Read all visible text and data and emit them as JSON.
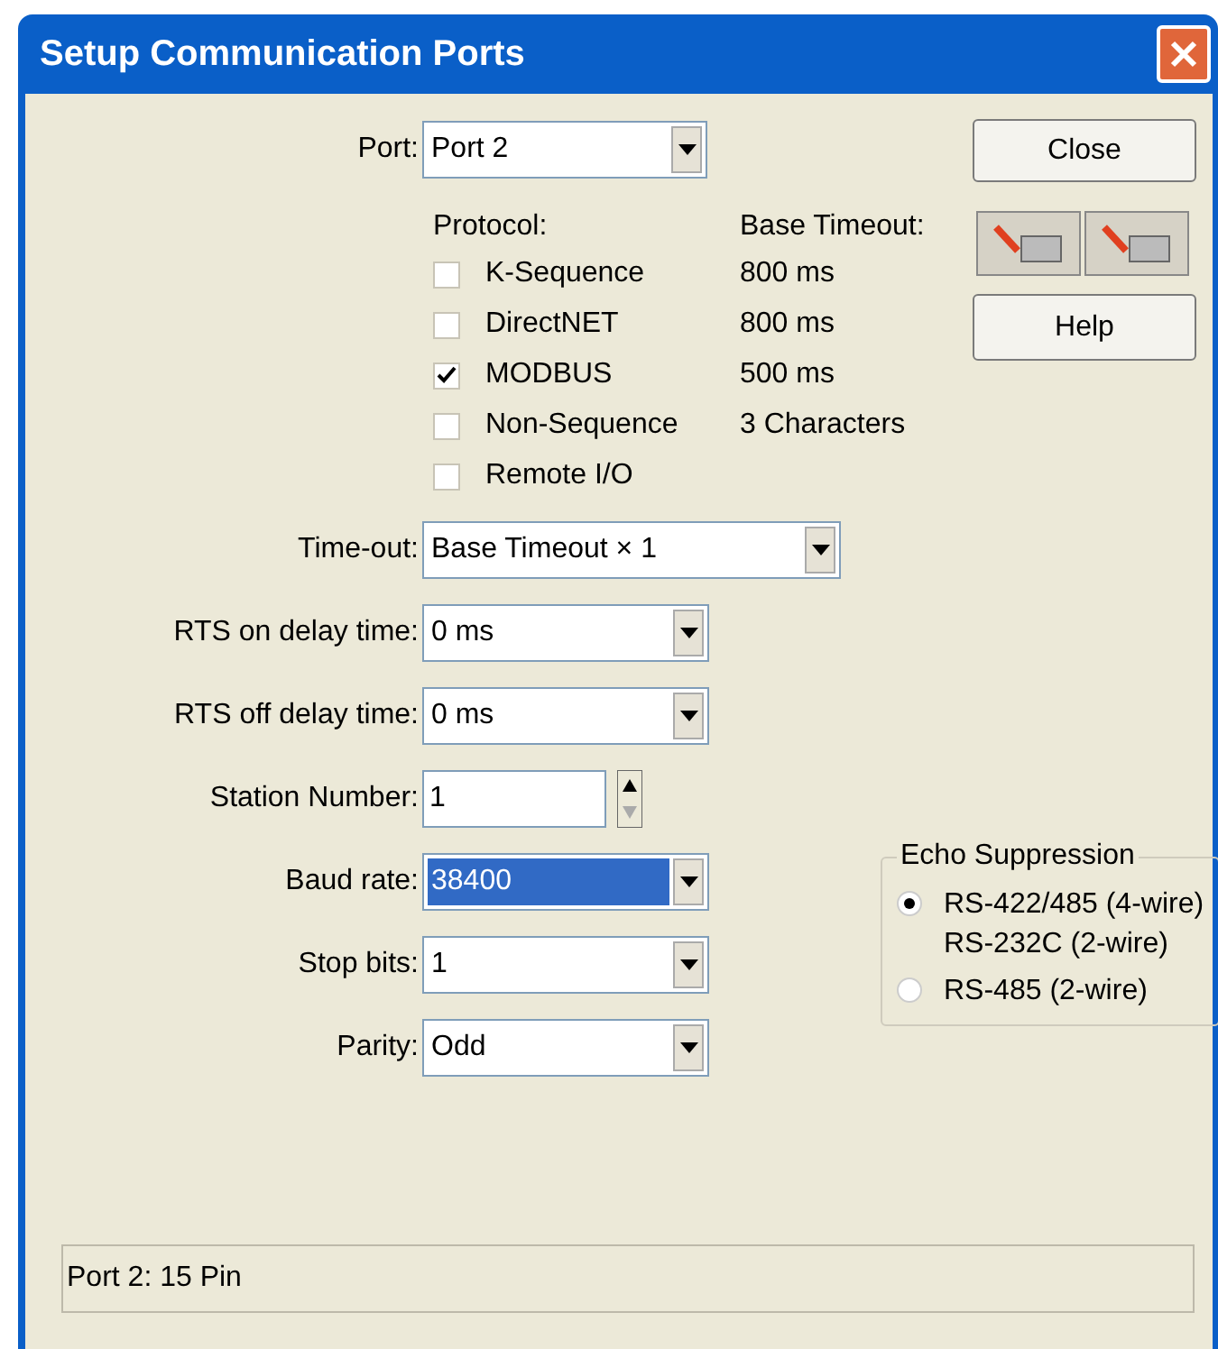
{
  "window": {
    "title": "Setup Communication Ports"
  },
  "port": {
    "label": "Port:",
    "value": "Port 2"
  },
  "protocol_header": "Protocol:",
  "timeout_header": "Base Timeout:",
  "protocols": [
    {
      "name": "K-Sequence",
      "timeout": "800 ms",
      "checked": false
    },
    {
      "name": "DirectNET",
      "timeout": "800 ms",
      "checked": false
    },
    {
      "name": "MODBUS",
      "timeout": "500 ms",
      "checked": true
    },
    {
      "name": "Non-Sequence",
      "timeout": "3 Characters",
      "checked": false
    },
    {
      "name": "Remote I/O",
      "checked": false
    }
  ],
  "fields": [
    {
      "kind": "select",
      "label": "Time-out:",
      "value": "Base Timeout × 1"
    },
    {
      "kind": "select",
      "label": "RTS on delay time:",
      "value": "0 ms"
    },
    {
      "kind": "select",
      "label": "RTS off delay time:",
      "value": "0 ms"
    },
    {
      "kind": "spin",
      "label": "Station Number:",
      "value": "1"
    },
    {
      "kind": "select",
      "label": "Baud rate:",
      "value": "38400",
      "highlighted": true
    },
    {
      "kind": "select",
      "label": "Stop bits:",
      "value": "1"
    },
    {
      "kind": "select",
      "label": "Parity:",
      "value": "Odd"
    }
  ],
  "buttons": {
    "close": "Close",
    "help": "Help"
  },
  "echo": {
    "title": "Echo Suppression",
    "options": [
      {
        "lines": [
          "RS-422/485 (4-wire)",
          "RS-232C (2-wire)"
        ],
        "selected": true
      },
      {
        "lines": [
          "RS-485 (2-wire)"
        ],
        "selected": false
      }
    ]
  },
  "status_bar": "Port 2: 15 Pin"
}
